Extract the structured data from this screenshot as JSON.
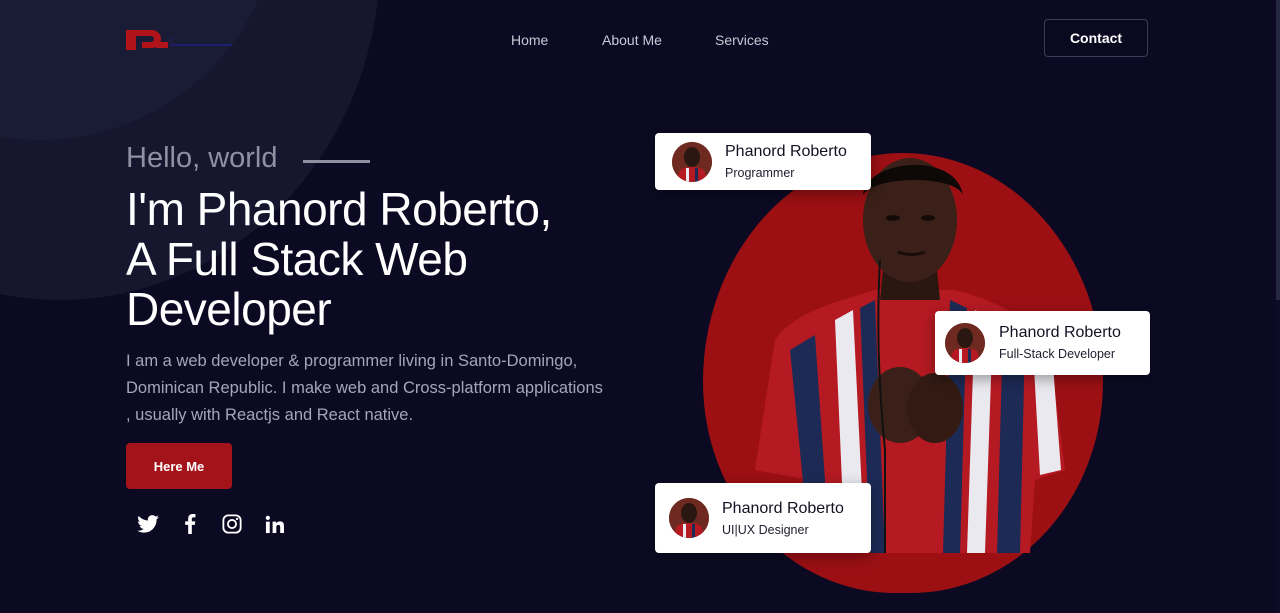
{
  "brand": {
    "logo_letter": "P"
  },
  "nav": {
    "items": [
      {
        "label": "Home"
      },
      {
        "label": "About Me"
      },
      {
        "label": "Services"
      }
    ],
    "contact_label": "Contact"
  },
  "hero": {
    "greeting": "Hello, world",
    "headline_lines": [
      "I'm Phanord Roberto,",
      "A Full Stack Web",
      "Developer"
    ],
    "intro_lines": [
      "I am a web developer & programmer living in Santo-Domingo,",
      "Dominican Republic. I make web and Cross-platform applications",
      ", usually with Reactjs and React native."
    ],
    "cta_label": "Here Me"
  },
  "socials": [
    {
      "icon": "twitter-icon"
    },
    {
      "icon": "facebook-icon"
    },
    {
      "icon": "instagram-icon"
    },
    {
      "icon": "linkedin-icon"
    }
  ],
  "cards": [
    {
      "name": "Phanord Roberto",
      "role": "Programmer"
    },
    {
      "name": "Phanord Roberto",
      "role": "Full-Stack Developer"
    },
    {
      "name": "Phanord Roberto",
      "role": "UI|UX Designer"
    }
  ],
  "colors": {
    "background": "#0b0a22",
    "accent": "#a3141a",
    "text_muted": "#a4a6b8"
  }
}
